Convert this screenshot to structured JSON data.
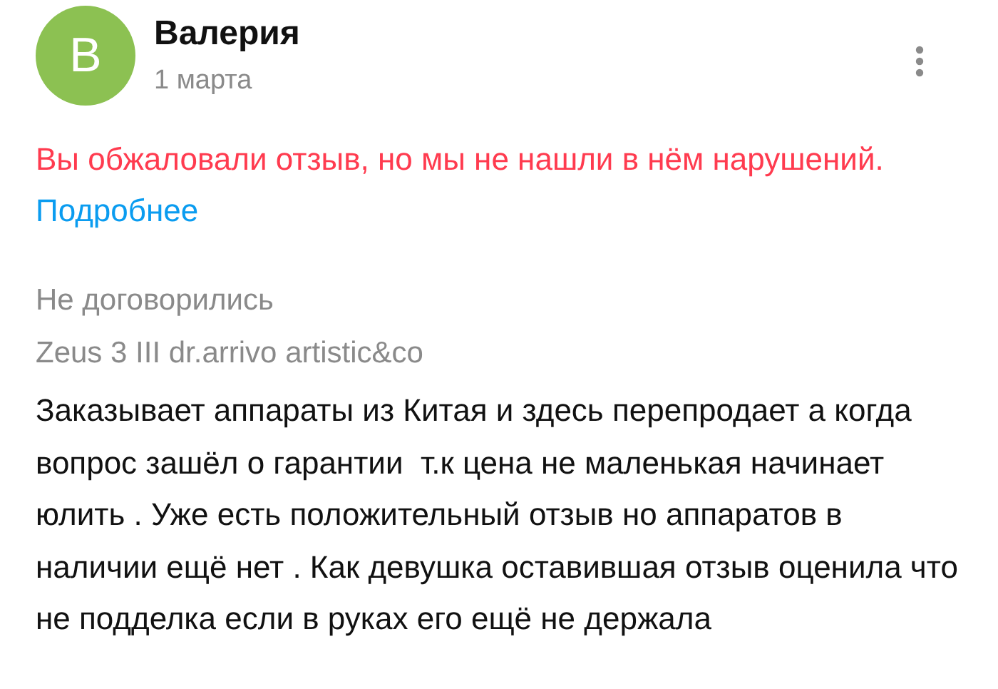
{
  "review": {
    "avatar_letter": "В",
    "author": "Валерия",
    "date": "1 марта",
    "notice": {
      "text": "Вы обжаловали отзыв, но мы не нашли в нём нарушений.",
      "link": "Подробнее"
    },
    "deal_status": "Не договорились",
    "item": "Zeus 3 III dr.arrivo artistic&co",
    "body": "Заказывает аппараты из Китая и здесь перепродает а когда вопрос зашёл о гарантии  т.к цена не маленькая начинает юлить . Уже есть положительный отзыв но аппаратов в наличии ещё нет . Как девушка оставившая отзыв оценила что не подделка если в руках его ещё не держала"
  }
}
